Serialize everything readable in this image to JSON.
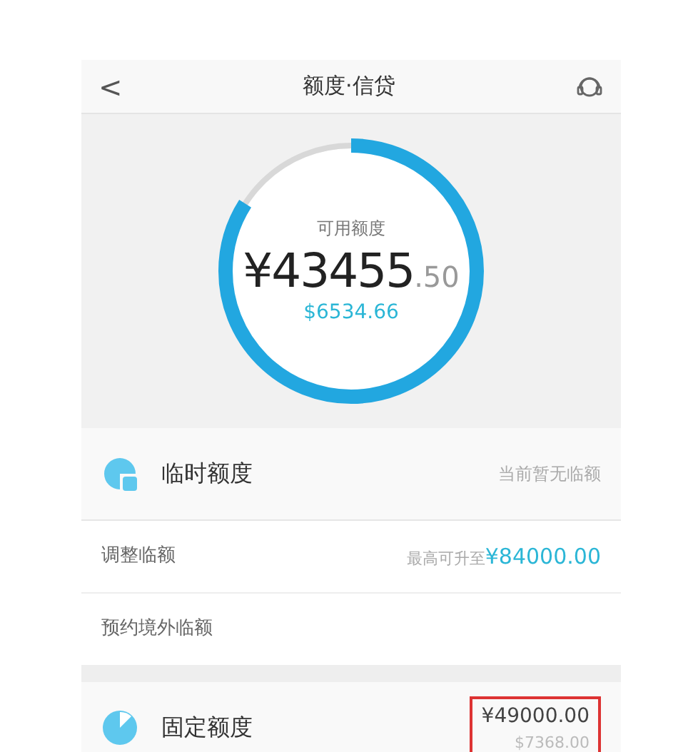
{
  "header": {
    "back": "<",
    "title": "额度·信贷"
  },
  "gauge": {
    "level": 0.84,
    "label": "可用额度",
    "currency": "¥",
    "amount": "43455",
    "decimals": ".50",
    "usd": "$6534.66"
  },
  "sections": [
    {
      "kind": "header",
      "title": "临时额度",
      "value": "当前暂无临额"
    },
    {
      "kind": "row",
      "title": "调整临额",
      "prefix": "最高可升至",
      "value": "¥84000.00"
    },
    {
      "kind": "row",
      "title": "预约境外临额"
    },
    {
      "kind": "gap"
    },
    {
      "kind": "header",
      "title": "固定额度",
      "value": "¥49000.00",
      "sub": "$7368.00",
      "highlighted": true
    }
  ]
}
